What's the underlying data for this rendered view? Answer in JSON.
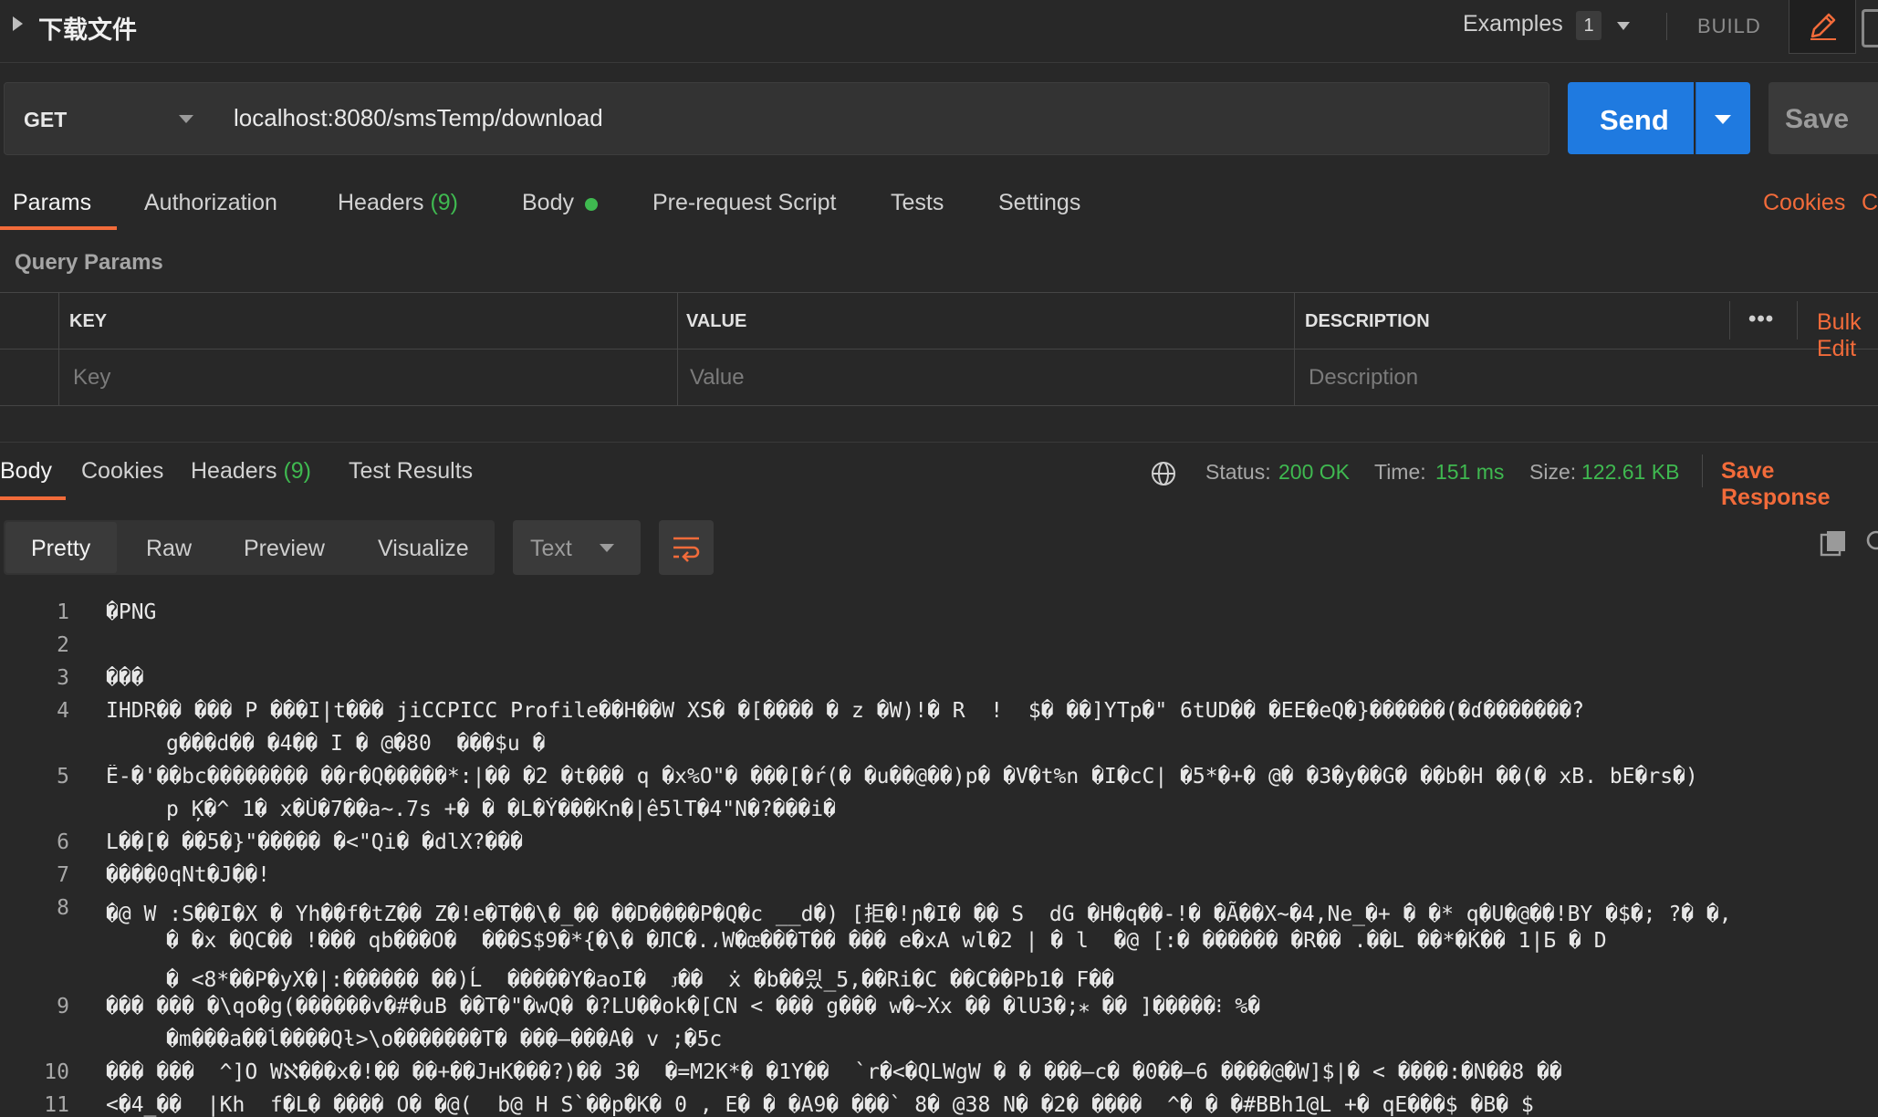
{
  "header": {
    "request_name": "下载文件",
    "examples_label": "Examples",
    "examples_count": "1",
    "build_label": "BUILD"
  },
  "url_bar": {
    "method": "GET",
    "url": "localhost:8080/smsTemp/download",
    "send_label": "Send",
    "save_label": "Save"
  },
  "request_tabs": {
    "params": "Params",
    "authorization": "Authorization",
    "headers": "Headers",
    "headers_count": "(9)",
    "body": "Body",
    "prerequest": "Pre-request Script",
    "tests": "Tests",
    "settings": "Settings",
    "cookies": "Cookies",
    "code": "Code"
  },
  "query_params": {
    "title": "Query Params",
    "col_key": "KEY",
    "col_value": "VALUE",
    "col_description": "DESCRIPTION",
    "more": "•••",
    "bulk_edit": "Bulk Edit",
    "placeholder_key": "Key",
    "placeholder_value": "Value",
    "placeholder_description": "Description"
  },
  "response": {
    "tabs": {
      "body": "Body",
      "cookies": "Cookies",
      "headers": "Headers",
      "headers_count": "(9)",
      "test_results": "Test Results"
    },
    "status_label": "Status:",
    "status_value": "200 OK",
    "time_label": "Time:",
    "time_value": "151 ms",
    "size_label": "Size:",
    "size_value": "122.61 KB",
    "save_response": "Save Response"
  },
  "view": {
    "pretty": "Pretty",
    "raw": "Raw",
    "preview": "Preview",
    "visualize": "Visualize",
    "format": "Text"
  },
  "code_lines": [
    {
      "n": "1",
      "t": "�PNG"
    },
    {
      "n": "2",
      "t": ""
    },
    {
      "n": "3",
      "t": "���"
    },
    {
      "n": "4",
      "t": "IHDR�� ��� P ���I|t��� jiCCPICC Profile��H��W XS� �[���� � z �W)!� R  !  $� ��]YTp�\" 6tUD�� �EE�eQ�}������(�ɗ�������̑?"
    },
    {
      "n": "",
      "t": "g���d�� �4�� I � @�80  ���$u �"
    },
    {
      "n": "5",
      "t": "Ë-�'��bc�������� ��r�Q�����*:|�� �2 �t��� q �x%O\"� ���[�ŕ(� �u��@��)p� �V�t%n �I�cC| �5*�+� @� �3�y��G� ��b�H ��(� xB. bE�rs�)"
    },
    {
      "n": "",
      "t": "p Ķ�^ 1� x�Ù�7��a~.7s +� � �L�Ý���Kn�|ê5lT�4\"N�?���i�"
    },
    {
      "n": "6",
      "t": "L��[� ��5�}\"����� �<\"Qi� �dlX?���"
    },
    {
      "n": "7",
      "t": "����0qNt�J��!"
    },
    {
      "n": "8",
      "t": "�@ W :S��I�X � Yh��f�tZ�� Z�!e�T��\\�_�� ��D����P�Q�c __d�) [拒�!ɲ�I� �� S  dG �H�q��-!� �Ã��X~�4,Ne_�+ � �* q�U�@��!BY �$�; ?� �,"
    },
    {
      "n": "",
      "t": "� �x �QC�� !��� qb���O�  ���S$9�*{�\\� �ЛC�.،W�œ���T�� ��� e�xA wl�2 | � l  �@ [:� ������ �R�� .��L ��*�Ḱ�� 1|Ƃ � D"
    },
    {
      "n": "",
      "t": "� <8*��P�yX�|:������ ��)Ĺ  �����Y�aoI�  ꭻ��  ẋ �b��읬_5,��Ri�C ��C��Pb1� F��"
    },
    {
      "n": "9",
      "t": "��� ��� �\\qo�g(������v�#�uB ��T�\"�wQ� �?LU��ok�[CN < ��� g��� w�~Xx �� �lU3�;⁎ �� ]�����⁝ %�"
    },
    {
      "n": "",
      "t": "�m���a��ĺ����Qƚ>\\o�������T� ���—���A� v ;�5c"
    },
    {
      "n": "10",
      "t": "��� ���  ^]O Wℵ���x�!�� ��+��JʜK���?)�� 3�  �=M2K*� �1Y��  `r�<�QLWgW � � ���—c� �0��—6 ����@�W]$|� < ����:�N��8 ��"
    },
    {
      "n": "11",
      "t": "<�4_��  |Kh  f�L� ���� O� �@(  b@ H S`��p�K� 0 , E� � �A9� ���` 8� @38 N� �2� ����  ^� � �#BBh1@L +� qE���$ �B� $"
    }
  ]
}
